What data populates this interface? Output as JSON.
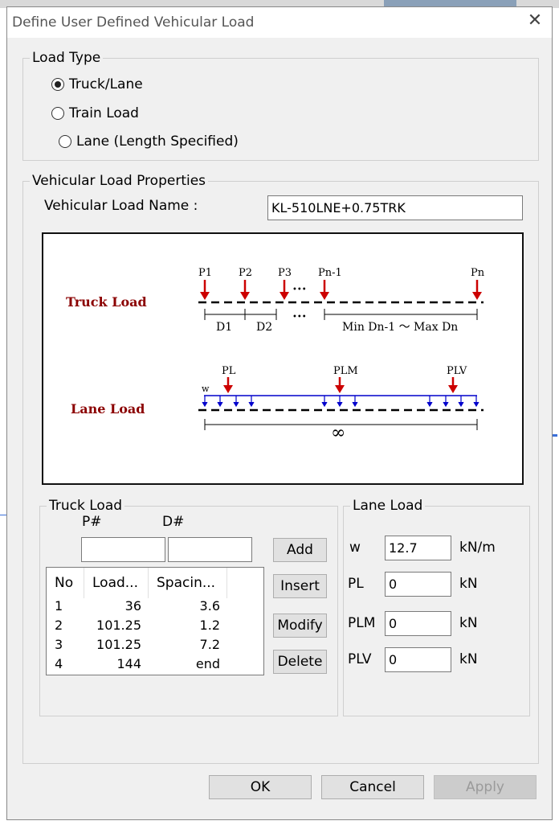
{
  "dialog": {
    "title": "Define User Defined Vehicular Load",
    "close_glyph": "✕"
  },
  "load_type": {
    "legend": "Load Type",
    "options": [
      {
        "label": "Truck/Lane",
        "selected": true
      },
      {
        "label": "Train Load",
        "selected": false
      },
      {
        "label": "Lane (Length Specified)",
        "selected": false
      }
    ]
  },
  "properties": {
    "legend": "Vehicular Load Properties",
    "name_label": "Vehicular Load Name :",
    "name_value": "KL-510LNE+0.75TRK"
  },
  "diagram": {
    "truck_title": "Truck  Load",
    "lane_title": "Lane  Load",
    "truck_point_labels": [
      "P1",
      "P2",
      "P3",
      "Pn-1",
      "Pn"
    ],
    "truck_dots": "•••",
    "spacing_labels": [
      "D1",
      "D2",
      "Min Dn-1 ～ Max Dn"
    ],
    "lane_point_labels": [
      "PL",
      "PLM",
      "PLV"
    ],
    "lane_w_label": "w",
    "infinity": "∞",
    "colors": {
      "title": "#8b0000",
      "arrow_red": "#cc0000",
      "arrow_blue": "#0000cc",
      "line": "#000000"
    }
  },
  "truck_load": {
    "legend": "Truck Load",
    "p_label": "P#",
    "d_label": "D#",
    "p_value": "",
    "d_value": "",
    "columns": [
      "No",
      "Load...",
      "Spacin..."
    ],
    "rows": [
      {
        "no": "1",
        "load": "36",
        "spacing": "3.6"
      },
      {
        "no": "2",
        "load": "101.25",
        "spacing": "1.2"
      },
      {
        "no": "3",
        "load": "101.25",
        "spacing": "7.2"
      },
      {
        "no": "4",
        "load": "144",
        "spacing": "end"
      }
    ],
    "buttons": {
      "add": "Add",
      "insert": "Insert",
      "modify": "Modify",
      "delete": "Delete"
    }
  },
  "lane_load": {
    "legend": "Lane Load",
    "fields": [
      {
        "label": "w",
        "value": "12.7",
        "unit": "kN/m"
      },
      {
        "label": "PL",
        "value": "0",
        "unit": "kN"
      },
      {
        "label": "PLM",
        "value": "0",
        "unit": "kN"
      },
      {
        "label": "PLV",
        "value": "0",
        "unit": "kN"
      }
    ]
  },
  "footer": {
    "ok": "OK",
    "cancel": "Cancel",
    "apply": "Apply"
  }
}
